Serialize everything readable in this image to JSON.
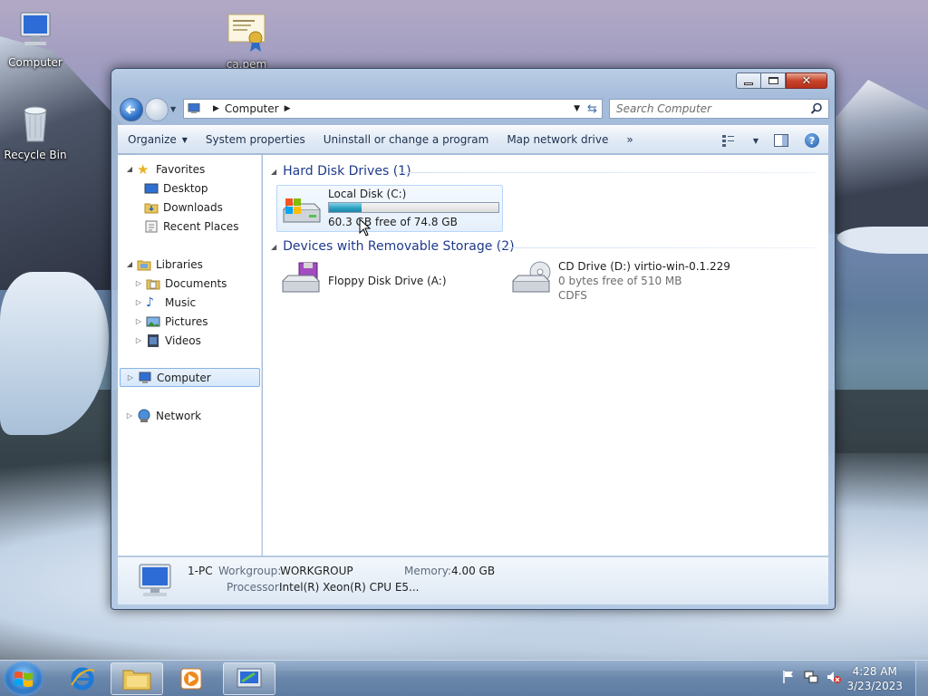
{
  "desktop": {
    "icons": [
      {
        "label": "Computer"
      },
      {
        "label": "ca.pem"
      },
      {
        "label": "Recycle Bin"
      }
    ]
  },
  "window": {
    "address": {
      "path_root": "Computer"
    },
    "search": {
      "placeholder": "Search Computer"
    },
    "toolbar": {
      "organize": "Organize",
      "system_properties": "System properties",
      "uninstall": "Uninstall or change a program",
      "map_drive": "Map network drive",
      "more": "»"
    },
    "nav": {
      "favorites": "Favorites",
      "desktop": "Desktop",
      "downloads": "Downloads",
      "recent": "Recent Places",
      "libraries": "Libraries",
      "documents": "Documents",
      "music": "Music",
      "pictures": "Pictures",
      "videos": "Videos",
      "computer": "Computer",
      "network": "Network"
    },
    "groups": {
      "hdd": "Hard Disk Drives (1)",
      "removable": "Devices with Removable Storage (2)"
    },
    "drives": {
      "c": {
        "name": "Local Disk (C:)",
        "free_text": "60.3 GB free of 74.8 GB",
        "used_fraction": 0.194
      },
      "a": {
        "name": "Floppy Disk Drive (A:)"
      },
      "d": {
        "name": "CD Drive (D:) virtio-win-0.1.229",
        "free_text": "0 bytes free of 510 MB",
        "fs": "CDFS"
      }
    },
    "details": {
      "name": "1-PC",
      "workgroup_label": "Workgroup:",
      "workgroup": "WORKGROUP",
      "memory_label": "Memory:",
      "memory": "4.00 GB",
      "processor_label": "Processor:",
      "processor": "Intel(R) Xeon(R) CPU E5..."
    }
  },
  "taskbar": {
    "clock_time": "4:28 AM",
    "clock_date": "3/23/2023"
  }
}
